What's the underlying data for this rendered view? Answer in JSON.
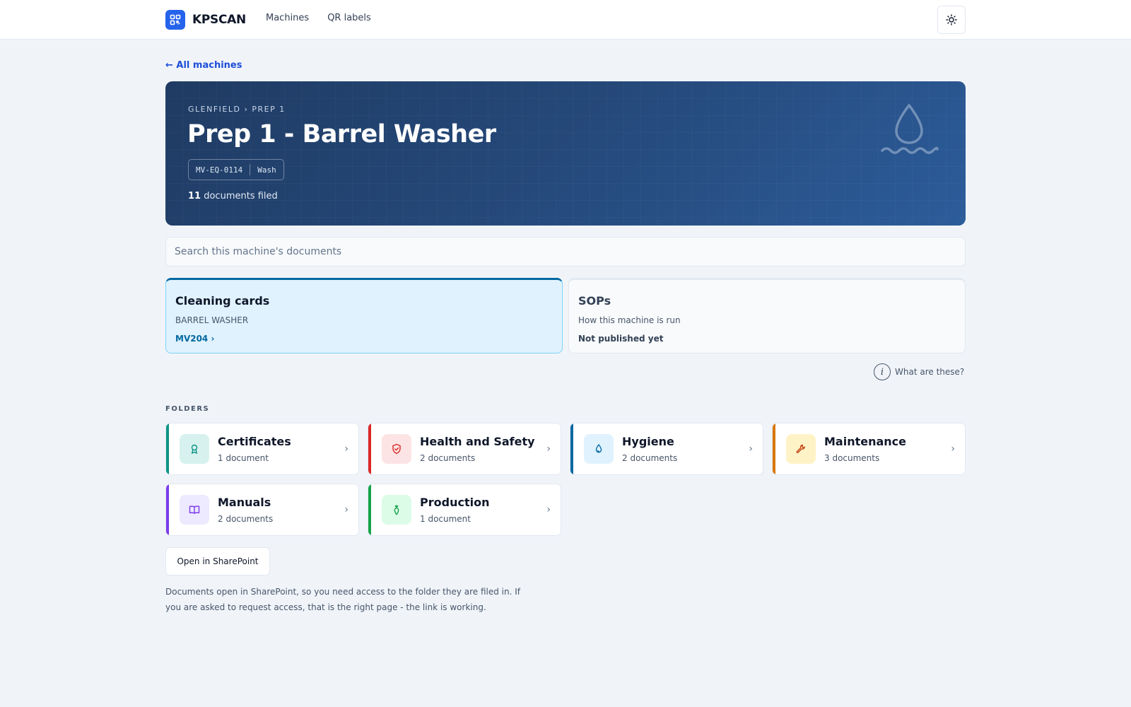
{
  "header": {
    "brand_name": "KPSCAN",
    "nav": [
      "Machines",
      "QR labels"
    ]
  },
  "back_link": "← All machines",
  "hero": {
    "breadcrumb": "GLENFIELD › PREP 1",
    "title": "Prep 1 - Barrel Washer",
    "asset_id": "MV-EQ-0114",
    "category": "Wash",
    "doc_count": "11",
    "doc_count_suffix": " documents filed"
  },
  "search": {
    "placeholder": "Search this machine's documents"
  },
  "cards": {
    "cleaning": {
      "title": "Cleaning cards",
      "subtitle": "BARREL WASHER",
      "link": "MV204 ›"
    },
    "sops": {
      "title": "SOPs",
      "subtitle": "How this machine is run",
      "status": "Not published yet"
    }
  },
  "what_are_these": "What are these?",
  "folders_label": "FOLDERS",
  "folders": [
    {
      "name": "Certificates",
      "count": "1 document",
      "icon": "award-icon",
      "color": "#0d9488",
      "bg": "#d7f2ee"
    },
    {
      "name": "Health and Safety",
      "count": "2 documents",
      "icon": "shield-check-icon",
      "color": "#dc2626",
      "bg": "#fde4e4"
    },
    {
      "name": "Hygiene",
      "count": "2 documents",
      "icon": "droplet-icon",
      "color": "#0369a1",
      "bg": "#e0f2fe"
    },
    {
      "name": "Maintenance",
      "count": "3 documents",
      "icon": "wrench-icon",
      "color": "#d97706",
      "bg": "#fef3c7"
    },
    {
      "name": "Manuals",
      "count": "2 documents",
      "icon": "book-icon",
      "color": "#7c3aed",
      "bg": "#ede9fe"
    },
    {
      "name": "Production",
      "count": "1 document",
      "icon": "carrot-icon",
      "color": "#16a34a",
      "bg": "#dcfce7"
    }
  ],
  "chevron": "›",
  "sharepoint_button": "Open in SharePoint",
  "note": "Documents open in SharePoint, so you need access to the folder they are filed in. If you are asked to request access, that is the right page - the link is working."
}
